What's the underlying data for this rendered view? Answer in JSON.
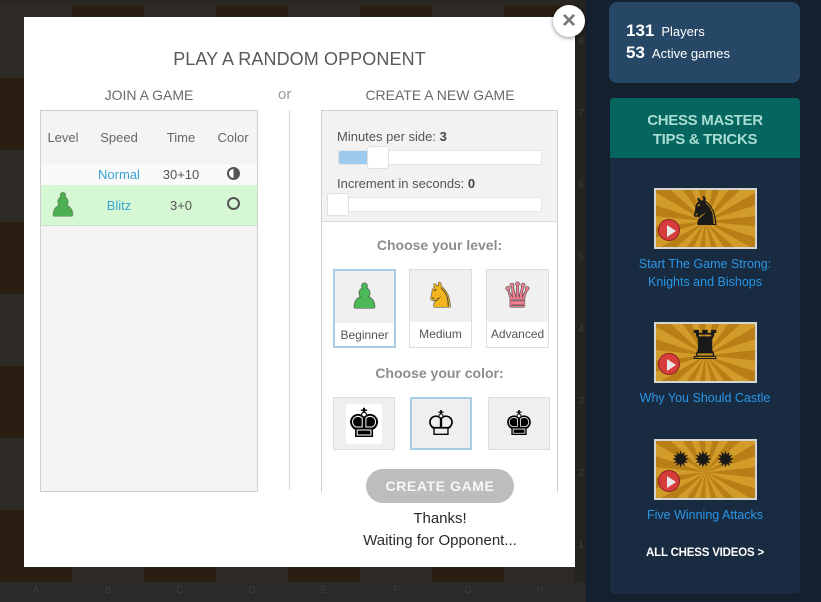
{
  "board": {
    "files": [
      "A",
      "B",
      "C",
      "D",
      "E",
      "F",
      "G",
      "H"
    ],
    "ranks": [
      "8",
      "7",
      "6",
      "5",
      "4",
      "3",
      "2",
      "1"
    ]
  },
  "modal": {
    "title": "PLAY A RANDOM OPPONENT",
    "close_icon": "×",
    "or_label": "or",
    "join": {
      "title": "JOIN A GAME",
      "columns": [
        "Level",
        "Speed",
        "Time",
        "Color"
      ],
      "rows": [
        {
          "level_icon": "",
          "speed": "Normal",
          "time": "30+10",
          "color": "random",
          "selected": false
        },
        {
          "level_icon": "♟",
          "speed": "Blitz",
          "time": "3+0",
          "color": "white",
          "selected": true
        }
      ]
    },
    "create": {
      "title": "CREATE A NEW GAME",
      "minutes_label": "Minutes per side:",
      "minutes_value": "3",
      "increment_label": "Increment in seconds:",
      "increment_value": "0",
      "minutes_slider_fraction": 0.12,
      "increment_slider_fraction": 0.0,
      "level_label": "Choose your level:",
      "levels": [
        {
          "label": "Beginner",
          "icon": "♟",
          "icon_name": "pawn-icon",
          "color": "#4cb858",
          "selected": true
        },
        {
          "label": "Medium",
          "icon": "♞",
          "icon_name": "knight-icon",
          "color": "#f2b51e",
          "selected": false
        },
        {
          "label": "Advanced",
          "icon": "♛",
          "icon_name": "queen-icon",
          "color": "#ef8090",
          "selected": false
        }
      ],
      "color_label": "Choose your color:",
      "colors": [
        {
          "name": "random",
          "icon": "♚",
          "selected": false
        },
        {
          "name": "white",
          "icon": "♔",
          "selected": true
        },
        {
          "name": "black",
          "icon": "♚",
          "selected": false
        }
      ],
      "button_label": "CREATE GAME",
      "status_line1": "Thanks!",
      "status_line2": "Waiting for Opponent..."
    }
  },
  "sidebar": {
    "stats": {
      "players_count": "131",
      "players_label": "Players",
      "games_count": "53",
      "games_label": "Active games"
    },
    "tips": {
      "title_line1": "CHESS MASTER",
      "title_line2": "TIPS & TRICKS",
      "videos": [
        {
          "title_line1": "Start The Game Strong:",
          "title_line2": "Knights and Bishops",
          "art": "♞"
        },
        {
          "title_line1": "Why You Should Castle",
          "title_line2": "",
          "art": "♜"
        },
        {
          "title_line1": "Five Winning Attacks",
          "title_line2": "",
          "art": "✹✹✹"
        }
      ],
      "all_videos_label": "ALL CHESS VIDEOS >"
    }
  },
  "colors": {
    "accent_link": "#2a96e6",
    "stats_bg": "#274766",
    "tips_header_bg": "#05655f",
    "selected_row_bg": "#d6f7d3",
    "button_disabled_bg": "#bdbdbd"
  }
}
